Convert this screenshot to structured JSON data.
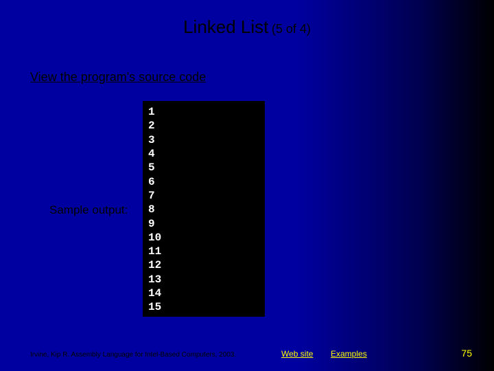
{
  "title": {
    "main": "Linked List",
    "sub": "(5 of 4)"
  },
  "source_link_label": "View the program's source code",
  "sample_label": "Sample output:",
  "output_lines": "1\n2\n3\n4\n5\n6\n7\n8\n9\n10\n11\n12\n13\n14\n15",
  "footer": {
    "citation": "Irvine, Kip R. Assembly Language for Intel-Based Computers, 2003.",
    "link_website": "Web site",
    "link_examples": "Examples",
    "page_number": "75"
  }
}
